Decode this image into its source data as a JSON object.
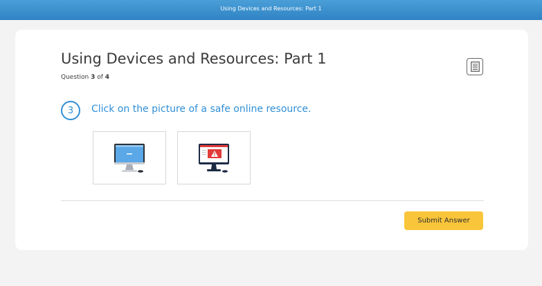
{
  "header": {
    "title": "Using Devices and Resources: Part 1"
  },
  "lesson": {
    "title": "Using Devices and Resources: Part 1",
    "progress_prefix": "Question ",
    "current": "3",
    "progress_mid": " of ",
    "total": "4"
  },
  "question": {
    "number": "3",
    "prompt": "Click on the picture of a safe online resource."
  },
  "choices": [
    {
      "icon": "safe-computer-icon",
      "screen_color": "#5aa8e8"
    },
    {
      "icon": "warning-computer-icon",
      "screen_color": "#ffffff",
      "alert_color": "#e23b3b"
    }
  ],
  "icons": {
    "notes": "notes-icon"
  },
  "actions": {
    "submit_label": "Submit Answer"
  },
  "colors": {
    "header": "#3a8fd0",
    "accent": "#2f8fd6",
    "submit": "#f9c53a",
    "background": "#f3f3f3"
  }
}
